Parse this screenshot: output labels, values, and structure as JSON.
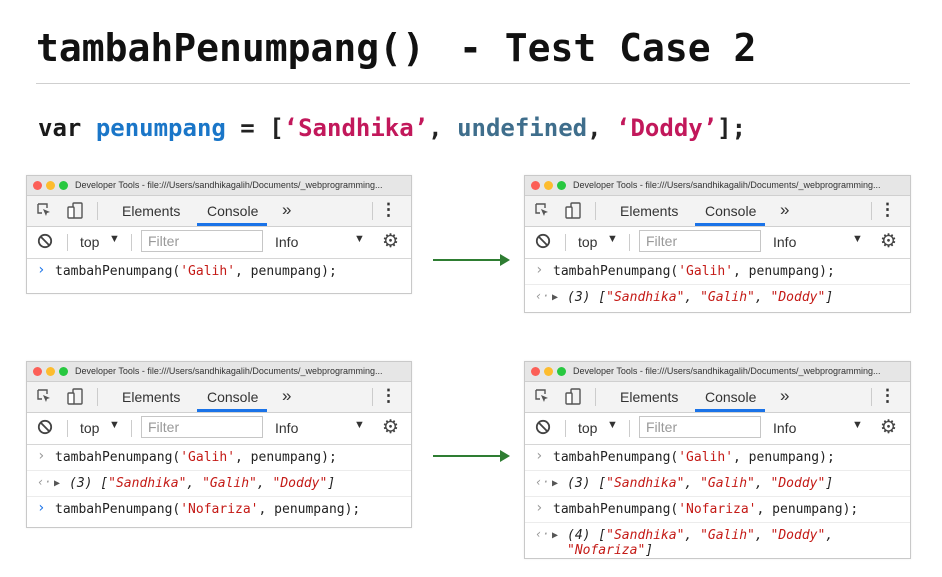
{
  "slide": {
    "title_fn": "tambahPenumpang()",
    "title_rest": "- Test Case 2",
    "code": {
      "kw": "var",
      "name": "penumpang",
      "eq": " = [",
      "s1": "‘Sandhika’",
      "c1": ", ",
      "undef": "undefined",
      "c2": ", ",
      "s2": "‘Doddy’",
      "end": "];"
    }
  },
  "devtools_common": {
    "window_title": "Developer Tools - file:///Users/sandhikagalih/Documents/_webprogramming...",
    "tab_elements": "Elements",
    "tab_console": "Console",
    "tab_more": "»",
    "context": "top",
    "filter_placeholder": "Filter",
    "levels": "Info"
  },
  "panels": [
    {
      "lines": [
        {
          "type": "input",
          "fn": "tambahPenumpang(",
          "arg1": "'Galih'",
          "rest": ", penumpang);"
        }
      ]
    },
    {
      "lines": [
        {
          "type": "done",
          "fn": "tambahPenumpang(",
          "arg1": "'Galih'",
          "rest": ", penumpang);"
        },
        {
          "type": "result",
          "count": "(3) [",
          "items": [
            "\"Sandhika\"",
            "\"Galih\"",
            "\"Doddy\""
          ],
          "close": "]"
        }
      ]
    },
    {
      "lines": [
        {
          "type": "done",
          "fn": "tambahPenumpang(",
          "arg1": "'Galih'",
          "rest": ", penumpang);"
        },
        {
          "type": "result",
          "count": "(3) [",
          "items": [
            "\"Sandhika\"",
            "\"Galih\"",
            "\"Doddy\""
          ],
          "close": "]"
        },
        {
          "type": "input",
          "fn": "tambahPenumpang(",
          "arg1": "'Nofariza'",
          "rest": ", penumpang);"
        }
      ]
    },
    {
      "lines": [
        {
          "type": "done",
          "fn": "tambahPenumpang(",
          "arg1": "'Galih'",
          "rest": ", penumpang);"
        },
        {
          "type": "result",
          "count": "(3) [",
          "items": [
            "\"Sandhika\"",
            "\"Galih\"",
            "\"Doddy\""
          ],
          "close": "]"
        },
        {
          "type": "done",
          "fn": "tambahPenumpang(",
          "arg1": "'Nofariza'",
          "rest": ", penumpang);"
        },
        {
          "type": "result",
          "count": "(4) [",
          "items": [
            "\"Sandhika\"",
            "\"Galih\"",
            "\"Doddy\"",
            "\"Nofariza\""
          ],
          "close": "]"
        }
      ]
    }
  ],
  "colors": {
    "arrow": "#2e7d32",
    "identifier": "#1a76c8",
    "string": "#c2185b",
    "undefined": "#3f6e8c",
    "console_string": "#c41a16"
  }
}
